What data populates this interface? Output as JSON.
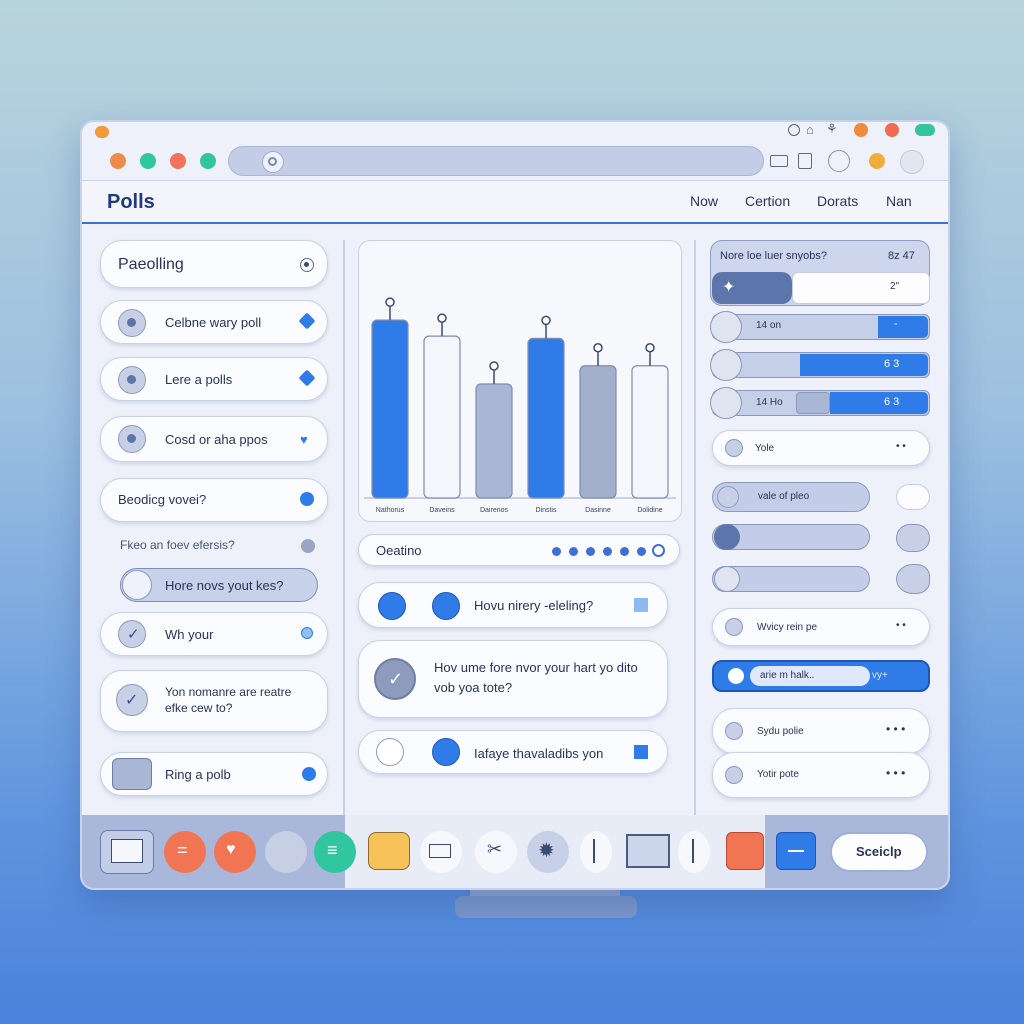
{
  "app": {
    "title": "Polls"
  },
  "header_nav": [
    "Now",
    "Certion",
    "Dorats",
    "Nan"
  ],
  "left_panel": {
    "items": [
      {
        "label": "Paeolling"
      },
      {
        "label": "Celbne wary poll"
      },
      {
        "label": "Lere a polls"
      },
      {
        "label": "Cosd or aha ppos"
      },
      {
        "label": "Beodicg vovei?"
      },
      {
        "label": "Fkeo an foev efersis?"
      },
      {
        "label": "Hore novs yout kes?"
      },
      {
        "label": "Wh your"
      },
      {
        "label": "Yon nomanre are reatre efke cew to?"
      },
      {
        "label": "Ring a polb"
      }
    ]
  },
  "chart_data": {
    "type": "bar",
    "categories": [
      "Nathorus",
      "Daveins",
      "Dairenos",
      "Dinstis",
      "Dasinne",
      "Dolidine"
    ],
    "values": [
      78,
      71,
      50,
      70,
      58,
      58
    ],
    "colors": [
      "#2f7be7",
      "#f5f6fb",
      "#a9b6d4",
      "#2f7be7",
      "#a4afcb",
      "#f5f6fb"
    ],
    "ylim": [
      0,
      100
    ]
  },
  "center_panel": {
    "filter_label": "Oeatino",
    "question_1": "Hovu nirery -eleling?",
    "question_2": "Hov ume fore nvor your hart yo dito vob yoa tote?",
    "question_3": "Iafaye thavaladibs yon"
  },
  "right_panel": {
    "header_text": "Nore loe luer snyobs?",
    "header_value": "8z 47",
    "top_slider_value": "2\"",
    "slider_rows": [
      {
        "label": "14 on",
        "value": "-",
        "level": 0.3
      },
      {
        "label": "",
        "value": "6 3",
        "level": 0.6
      },
      {
        "label": "14 Ho",
        "value": "6 3",
        "level": 0.75
      }
    ],
    "options": [
      {
        "label": "Yole",
        "value": "• •"
      },
      {
        "label": "vale of pleo",
        "value": ""
      },
      {
        "label": "",
        "value": ""
      },
      {
        "label": "",
        "value": ""
      },
      {
        "label": "Wvicy rein pe",
        "value": "• •"
      },
      {
        "label": "arie m halk..",
        "value": "vy+"
      },
      {
        "label": "Sydu polie",
        "value": "• • •"
      },
      {
        "label": "Yotir pote",
        "value": "• • •"
      }
    ]
  },
  "dock": {
    "cta_label": "Sceiclp",
    "icons": [
      "mail-icon",
      "menu-icon",
      "heart-icon",
      "face-icon",
      "list-icon",
      "tag-icon",
      "card-icon",
      "scissors-icon",
      "gear-icon",
      "pen-icon",
      "window-icon",
      "needle-icon",
      "close-icon",
      "minimize-icon"
    ]
  },
  "colors": {
    "accent": "#2f7be7",
    "panel": "#eef1f9",
    "border": "#c8d1ea"
  }
}
